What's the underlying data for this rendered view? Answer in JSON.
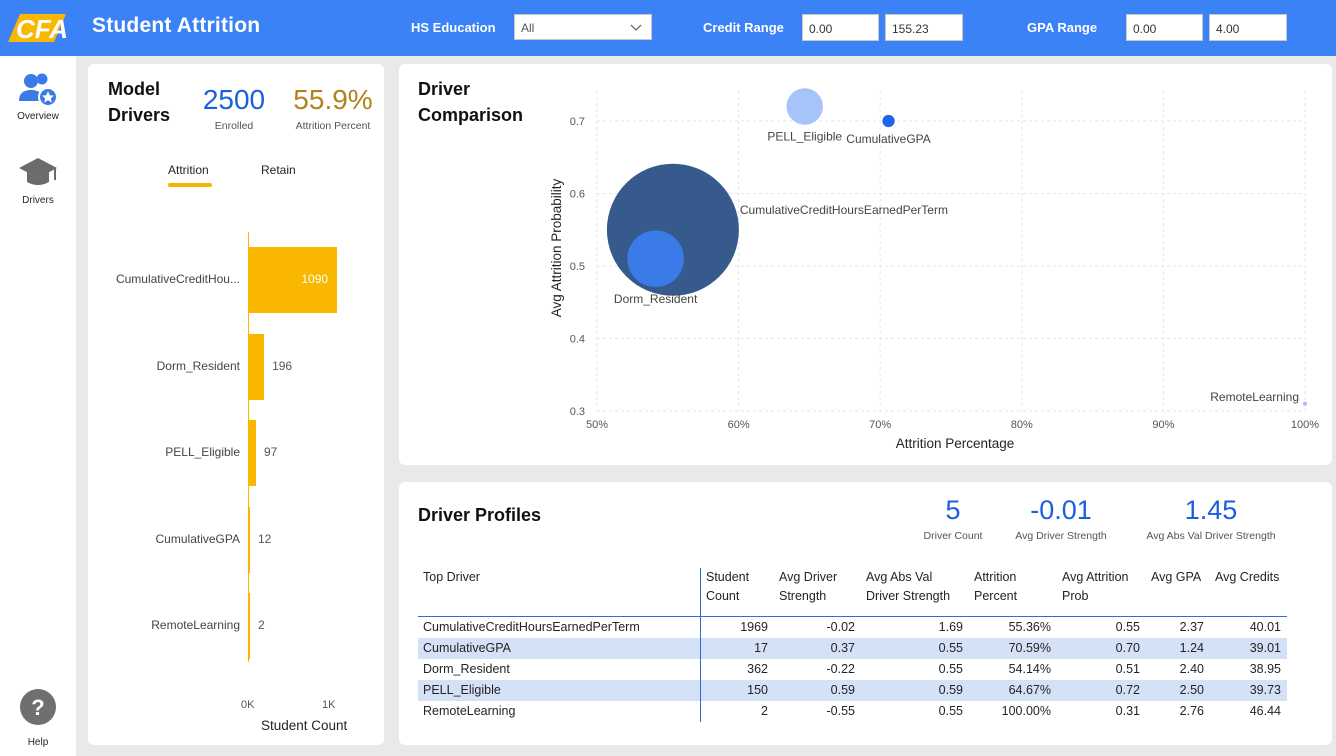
{
  "header": {
    "title": "Student Attrition",
    "filters": {
      "hs_education": {
        "label": "HS Education",
        "value": "All"
      },
      "credit_range": {
        "label": "Credit Range",
        "min": "0.00",
        "max": "155.23"
      },
      "gpa_range": {
        "label": "GPA Range",
        "min": "0.00",
        "max": "4.00"
      }
    }
  },
  "sidebar": {
    "items": [
      {
        "label": "Overview",
        "icon": "users-star-icon"
      },
      {
        "label": "Drivers",
        "icon": "graduation-cap-icon"
      },
      {
        "label": "Help",
        "icon": "help-icon"
      }
    ]
  },
  "model_drivers": {
    "title_line1": "Model",
    "title_line2": "Drivers",
    "kpis": [
      {
        "value": "2500",
        "label": "Enrolled",
        "color": "#1a5fe0"
      },
      {
        "value": "55.9%",
        "label": "Attrition Percent",
        "color": "#b0841a"
      }
    ],
    "tabs": [
      {
        "label": "Attrition",
        "active": true
      },
      {
        "label": "Retain",
        "active": false
      }
    ],
    "chart_data": {
      "type": "bar",
      "orientation": "horizontal",
      "categories": [
        "CumulativeCreditHou...",
        "Dorm_Resident",
        "PELL_Eligible",
        "CumulativeGPA",
        "RemoteLearning"
      ],
      "values": [
        1090,
        196,
        97,
        12,
        2
      ],
      "value_labels": [
        "1090",
        "196",
        "97",
        "12",
        "2"
      ],
      "xlabel": "Student Count",
      "xticks": [
        "0K",
        "1K"
      ],
      "xlim": [
        0,
        1000
      ],
      "color": "#f9b700"
    }
  },
  "driver_comparison": {
    "title_line1": "Driver",
    "title_line2": "Comparison",
    "chart_data": {
      "type": "scatter",
      "xlabel": "Attrition Percentage",
      "ylabel": "Avg Attrition Probability",
      "xlim": [
        50,
        100
      ],
      "ylim": [
        0.3,
        0.7
      ],
      "xticks": [
        "50%",
        "60%",
        "70%",
        "80%",
        "90%",
        "100%"
      ],
      "yticks": [
        "0.3",
        "0.4",
        "0.5",
        "0.6",
        "0.7"
      ],
      "points": [
        {
          "name": "CumulativeCreditHoursEarnedPerTerm",
          "x": 55.36,
          "y": 0.55,
          "size": 1969,
          "color": "#375a8c"
        },
        {
          "name": "Dorm_Resident",
          "x": 54.14,
          "y": 0.51,
          "size": 362,
          "color": "#3b7be8"
        },
        {
          "name": "PELL_Eligible",
          "x": 64.67,
          "y": 0.72,
          "size": 150,
          "color": "#a6c4f7"
        },
        {
          "name": "CumulativeGPA",
          "x": 70.59,
          "y": 0.7,
          "size": 17,
          "color": "#1f63e6"
        },
        {
          "name": "RemoteLearning",
          "x": 100.0,
          "y": 0.31,
          "size": 2,
          "color": "#a6c4f7"
        }
      ]
    }
  },
  "driver_profiles": {
    "title": "Driver Profiles",
    "kpis": [
      {
        "value": "5",
        "label": "Driver Count"
      },
      {
        "value": "-0.01",
        "label": "Avg Driver Strength"
      },
      {
        "value": "1.45",
        "label": "Avg Abs Val Driver Strength"
      }
    ],
    "table": {
      "columns": [
        {
          "line1": "Top Driver",
          "line2": ""
        },
        {
          "line1": "Student",
          "line2": "Count"
        },
        {
          "line1": "Avg Driver",
          "line2": "Strength"
        },
        {
          "line1": "Avg Abs Val",
          "line2": "Driver Strength"
        },
        {
          "line1": "Attrition",
          "line2": "Percent"
        },
        {
          "line1": "Avg Attrition",
          "line2": "Prob"
        },
        {
          "line1": "Avg GPA",
          "line2": ""
        },
        {
          "line1": "Avg Credits",
          "line2": ""
        }
      ],
      "rows": [
        [
          "CumulativeCreditHoursEarnedPerTerm",
          "1969",
          "-0.02",
          "1.69",
          "55.36%",
          "0.55",
          "2.37",
          "40.01"
        ],
        [
          "CumulativeGPA",
          "17",
          "0.37",
          "0.55",
          "70.59%",
          "0.70",
          "1.24",
          "39.01"
        ],
        [
          "Dorm_Resident",
          "362",
          "-0.22",
          "0.55",
          "54.14%",
          "0.51",
          "2.40",
          "38.95"
        ],
        [
          "PELL_Eligible",
          "150",
          "0.59",
          "0.59",
          "64.67%",
          "0.72",
          "2.50",
          "39.73"
        ],
        [
          "RemoteLearning",
          "2",
          "-0.55",
          "0.55",
          "100.00%",
          "0.31",
          "2.76",
          "46.44"
        ]
      ]
    }
  },
  "colors": {
    "header": "#3b82f6",
    "accent_gold": "#f9b700",
    "kpi_blue": "#1a5fe0",
    "row_alt": "#d4e1f7"
  }
}
